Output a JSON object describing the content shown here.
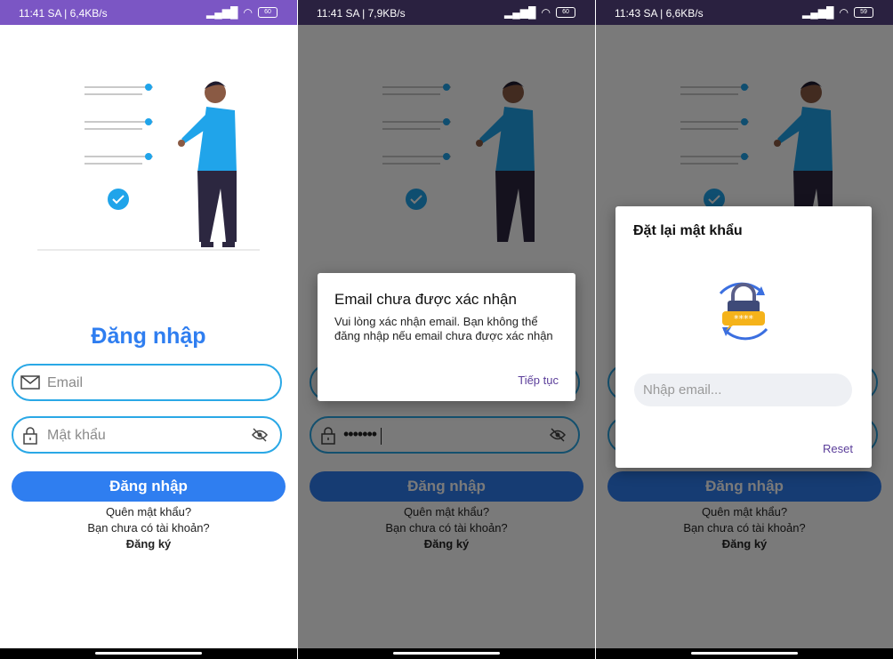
{
  "screens": [
    {
      "status": {
        "time": "11:41 SA | 6,4KB/s",
        "battery": "60"
      }
    },
    {
      "status": {
        "time": "11:41 SA | 7,9KB/s",
        "battery": "60"
      },
      "dialog": {
        "title": "Email chưa được xác nhận",
        "body": "Vui lòng xác nhận email. Bạn không thể đăng nhập nếu email chưa được xác nhận",
        "action": "Tiếp tục"
      }
    },
    {
      "status": {
        "time": "11:43 SA | 6,6KB/s",
        "battery": "59"
      },
      "dialog": {
        "title": "Đặt lại mật khẩu",
        "input_placeholder": "Nhập email...",
        "action": "Reset"
      }
    }
  ],
  "login": {
    "title": "Đăng nhập",
    "email_placeholder": "Email",
    "password_placeholder": "Mật khẩu",
    "password_masked": "•••••••",
    "submit_label": "Đăng nhập",
    "forgot_label": "Quên mật khẩu?",
    "no_account_label": "Bạn chưa có tài khoản?",
    "register_label": "Đăng ký"
  },
  "colors": {
    "accent": "#2f7ef0",
    "field_border": "#2aa8e6",
    "status_bar": "#7b56c4",
    "dialog_action": "#5b3e9a"
  },
  "icons": [
    "envelope-icon",
    "lock-icon",
    "eye-off-icon",
    "check-circle-icon",
    "wifi-icon",
    "signal-icon",
    "battery-icon"
  ]
}
